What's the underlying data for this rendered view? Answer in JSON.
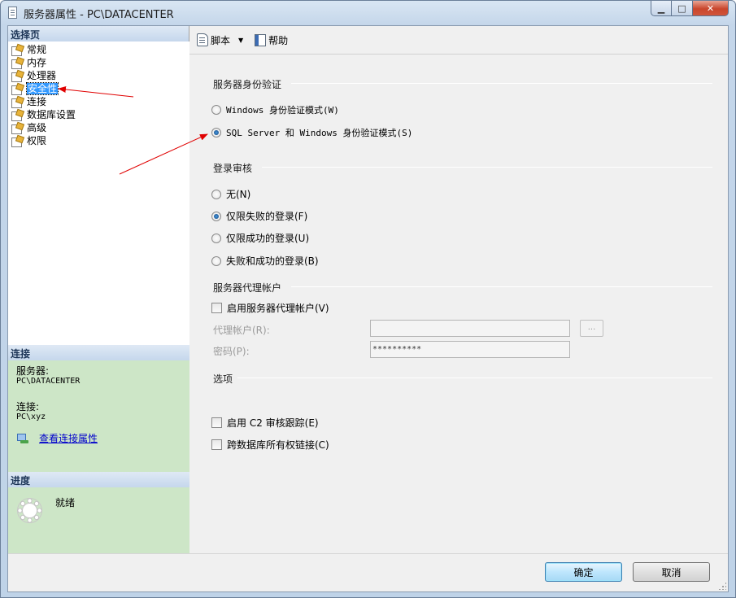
{
  "window": {
    "title": "服务器属性 - PC\\DATACENTER",
    "min_label": "▁",
    "max_label": "□",
    "close_label": "✕"
  },
  "left_pane": {
    "select_page_header": "选择页",
    "pages": [
      {
        "label": "常规",
        "selected": false
      },
      {
        "label": "内存",
        "selected": false
      },
      {
        "label": "处理器",
        "selected": false
      },
      {
        "label": "安全性",
        "selected": true
      },
      {
        "label": "连接",
        "selected": false
      },
      {
        "label": "数据库设置",
        "selected": false
      },
      {
        "label": "高级",
        "selected": false
      },
      {
        "label": "权限",
        "selected": false
      }
    ],
    "connection_header": "连接",
    "server_caption": "服务器:",
    "server_value": "PC\\DATACENTER",
    "connection_caption": "连接:",
    "connection_value": "PC\\xyz",
    "view_properties_link": "查看连接属性",
    "progress_header": "进度",
    "progress_status": "就绪"
  },
  "toolbar": {
    "script_label": "脚本",
    "dropdown_glyph": "▼",
    "help_label": "帮助"
  },
  "sections": {
    "auth_title": "服务器身份验证",
    "auth_options": [
      {
        "label": "Windows 身份验证模式(W)",
        "checked": false
      },
      {
        "label": "SQL Server 和 Windows 身份验证模式(S)",
        "checked": true
      }
    ],
    "audit_title": "登录审核",
    "audit_options": [
      {
        "label": "无(N)",
        "checked": false
      },
      {
        "label": "仅限失败的登录(F)",
        "checked": true
      },
      {
        "label": "仅限成功的登录(U)",
        "checked": false
      },
      {
        "label": "失败和成功的登录(B)",
        "checked": false
      }
    ],
    "proxy_title": "服务器代理帐户",
    "proxy_enable_label": "启用服务器代理帐户(V)",
    "proxy_account_label": "代理帐户(R):",
    "proxy_account_value": "",
    "password_label": "密码(P):",
    "password_value": "**********",
    "ellipsis_label": "...",
    "options_title": "选项",
    "c2_audit_label": "启用 C2 审核跟踪(E)",
    "cross_db_label": "跨数据库所有权链接(C)"
  },
  "buttons": {
    "ok": "确定",
    "cancel": "取消"
  },
  "colors": {
    "annotation_arrow": "#e00000",
    "selection": "#3399ff",
    "info_panel": "#cde6c7"
  }
}
